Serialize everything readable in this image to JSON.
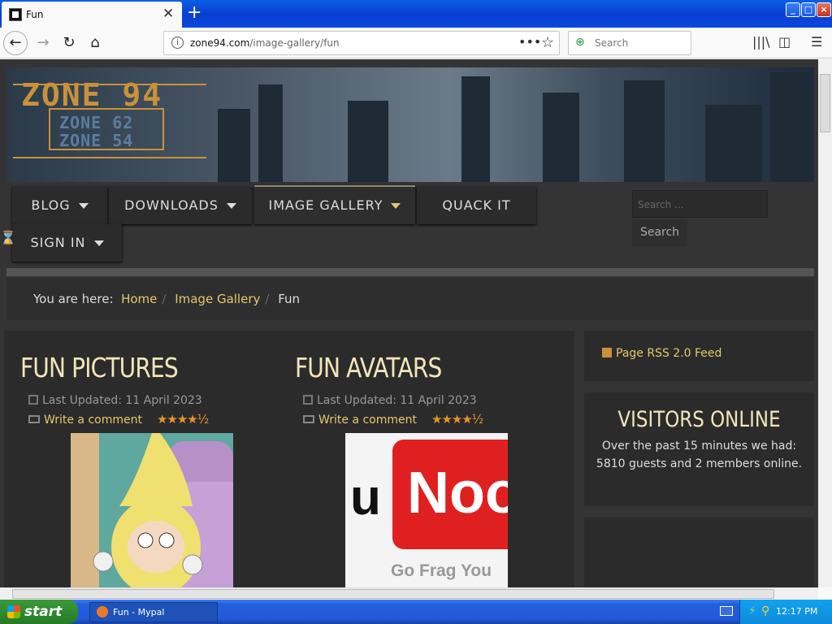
{
  "browser": {
    "tab_title": "Fun",
    "new_tab": "+",
    "url_domain": "zone94.com",
    "url_path": "/image-gallery/fun",
    "search_placeholder": "Search",
    "window_buttons": [
      "_",
      "□",
      "×"
    ]
  },
  "site": {
    "logo_main": "ZONE 94",
    "logo_sub1": "ZONE 62",
    "logo_sub2": "ZONE 54",
    "menu": [
      {
        "label": "BLOG",
        "has_dropdown": true
      },
      {
        "label": "DOWNLOADS",
        "has_dropdown": true
      },
      {
        "label": "IMAGE GALLERY",
        "has_dropdown": true,
        "active": true
      },
      {
        "label": "QUACK IT",
        "has_dropdown": false
      },
      {
        "label": "SIGN IN",
        "has_dropdown": true
      }
    ],
    "search_placeholder": "Search ...",
    "search_button": "Search",
    "breadcrumb": {
      "prefix": "You are here:",
      "items": [
        "Home",
        "Image Gallery",
        "Fun"
      ]
    },
    "articles": [
      {
        "title": "FUN PICTURES",
        "updated": "Last Updated: 11 April 2023",
        "comment": "Write a comment",
        "rating": "★★★★½"
      },
      {
        "title": "FUN AVATARS",
        "updated": "Last Updated: 11 April 2023",
        "comment": "Write a comment",
        "rating": "★★★★½"
      }
    ],
    "thumb2_text": "Noo",
    "thumb2_left": "u",
    "thumb2_caption": "Go Frag You",
    "rss": "Page RSS 2.0 Feed",
    "visitors": {
      "title": "VISITORS ONLINE",
      "text": "Over the past 15 minutes we had: 5810 guests and 2 members online."
    }
  },
  "taskbar": {
    "start": "start",
    "task": "Fun - Mypal",
    "clock": "12:17 PM"
  },
  "colors": {
    "accent": "#e5c96a",
    "heading": "#f3e6b8",
    "bg": "#343434"
  }
}
